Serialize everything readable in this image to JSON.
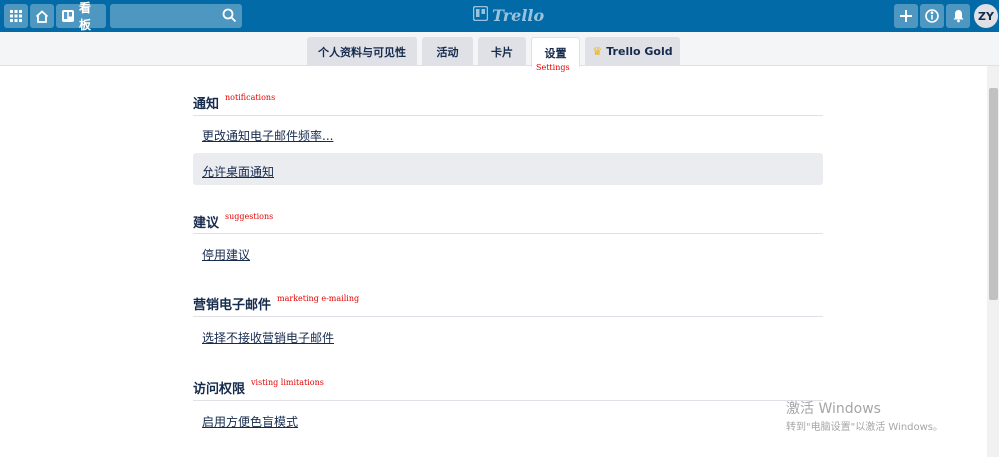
{
  "header": {
    "boards_label": "看板",
    "search_value": "",
    "logo_text": "Trello",
    "avatar_initials": "ZY",
    "brand_color": "#026aa7"
  },
  "tabs": [
    {
      "label": "个人资料与可见性",
      "active": false
    },
    {
      "label": "活动",
      "active": false
    },
    {
      "label": "卡片",
      "active": false
    },
    {
      "label": "设置",
      "active": true
    },
    {
      "label": "Trello Gold",
      "active": false,
      "icon": "crown-icon"
    }
  ],
  "annotations": {
    "settings": "Settings",
    "notifications": "notifications",
    "suggestions": "suggestions",
    "marketing": "marketing e-mailing",
    "visiting": "visting limitations"
  },
  "sections": [
    {
      "title": "通知",
      "links": [
        "更改通知电子邮件频率...",
        "允许桌面通知"
      ]
    },
    {
      "title": "建议",
      "links": [
        "停用建议"
      ]
    },
    {
      "title": "营销电子邮件",
      "links": [
        "选择不接收营销电子邮件"
      ]
    },
    {
      "title": "访问权限",
      "links": [
        "启用方便色盲模式"
      ]
    }
  ],
  "watermark": {
    "line1": "激活 Windows",
    "line2": "转到\"电脑设置\"以激活 Windows。"
  }
}
